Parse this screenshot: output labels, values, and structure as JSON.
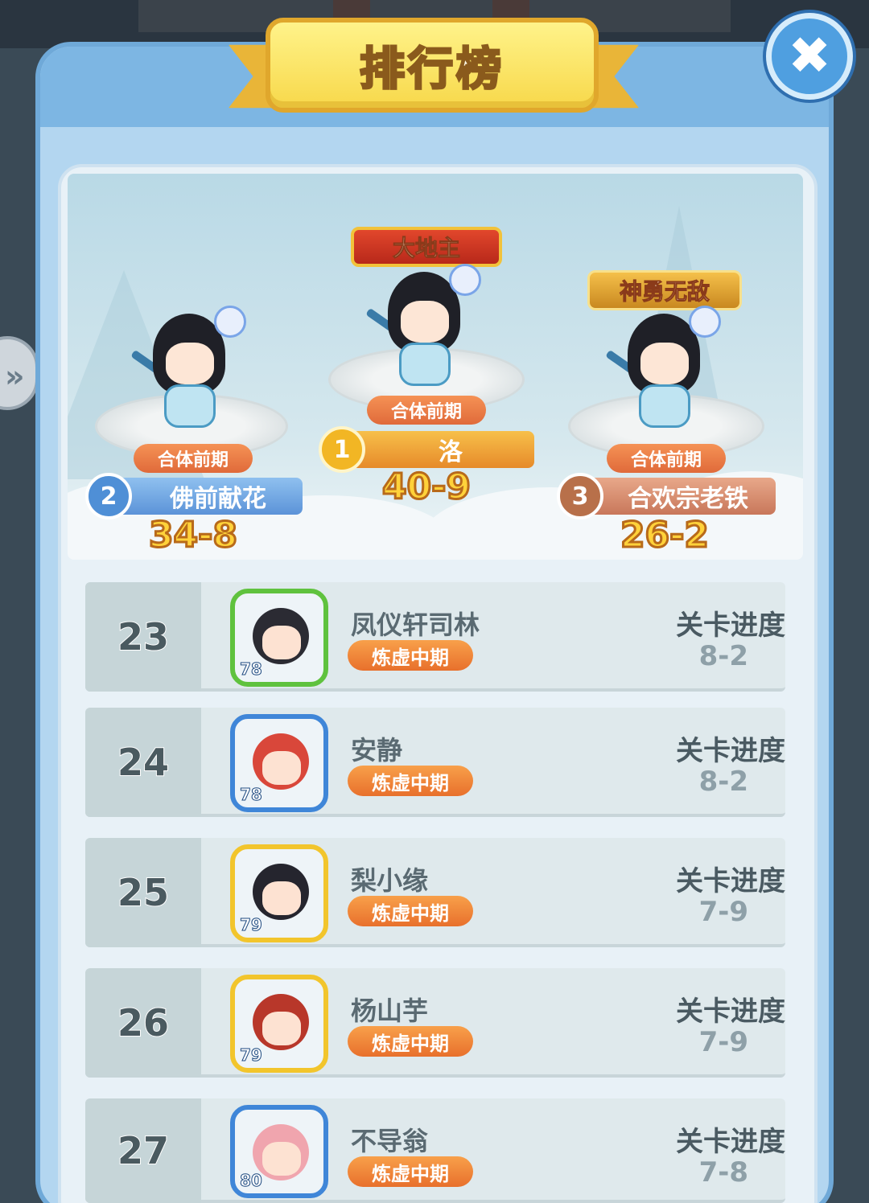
{
  "header": {
    "title": "排行榜"
  },
  "close_button": {
    "icon": "close-icon",
    "glyph": "✖"
  },
  "side_handle": {
    "icon": "chevron-right-icon",
    "glyph": "»"
  },
  "podium": {
    "first": {
      "rank": "1",
      "name": "洛",
      "realm": "合体前期",
      "score": "40-9",
      "title": "大地主"
    },
    "second": {
      "rank": "2",
      "name": "佛前献花",
      "realm": "合体前期",
      "score": "34-8"
    },
    "third": {
      "rank": "3",
      "name": "合欢宗老铁",
      "realm": "合体前期",
      "score": "26-2",
      "title": "神勇无敌"
    }
  },
  "list": {
    "progress_label": "关卡进度",
    "rows": [
      {
        "rank": "23",
        "name": "凤仪轩司林",
        "realm": "炼虚中期",
        "level": "78",
        "progress": "8-2",
        "frame_color": "#5fc23e",
        "hair_color": "#2b2b33"
      },
      {
        "rank": "24",
        "name": "安静",
        "realm": "炼虚中期",
        "level": "78",
        "progress": "8-2",
        "frame_color": "#3f86d8",
        "hair_color": "#d9473a"
      },
      {
        "rank": "25",
        "name": "梨小缘",
        "realm": "炼虚中期",
        "level": "79",
        "progress": "7-9",
        "frame_color": "#f2c52c",
        "hair_color": "#25252e"
      },
      {
        "rank": "26",
        "name": "杨山芋",
        "realm": "炼虚中期",
        "level": "79",
        "progress": "7-9",
        "frame_color": "#f2c52c",
        "hair_color": "#b8372a"
      },
      {
        "rank": "27",
        "name": "不导翁",
        "realm": "炼虚中期",
        "level": "80",
        "progress": "7-8",
        "frame_color": "#3f86d8",
        "hair_color": "#f0a5ae"
      }
    ]
  }
}
